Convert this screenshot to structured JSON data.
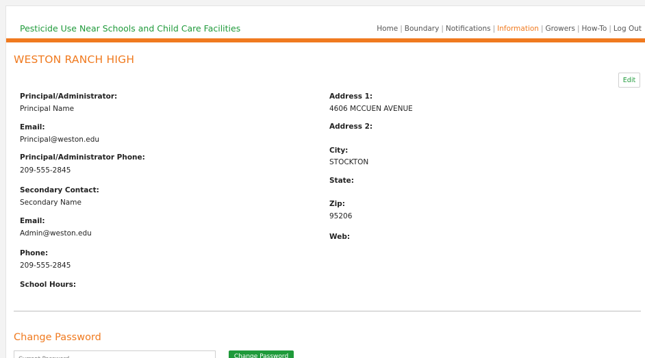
{
  "header": {
    "site_title": "Pesticide Use Near Schools and Child Care Facilities",
    "nav": [
      "Home",
      "Boundary",
      "Notifications",
      "Information",
      "Growers",
      "How-To",
      "Log Out"
    ],
    "active_nav": "Information",
    "separator": "|"
  },
  "school": {
    "name": "WESTON RANCH HIGH",
    "edit_label": "Edit"
  },
  "left_fields": [
    {
      "label": "Principal/Administrator:",
      "value": "Principal Name"
    },
    {
      "label": "Email:",
      "value": "Principal@weston.edu"
    },
    {
      "label": "Principal/Administrator Phone:",
      "value": "209-555-2845"
    },
    {
      "label": "Secondary Contact:",
      "value": "Secondary Name"
    },
    {
      "label": "Email:",
      "value": "Admin@weston.edu"
    },
    {
      "label": "Phone:",
      "value": "209-555-2845"
    },
    {
      "label": "School Hours:",
      "value": ""
    }
  ],
  "right_fields": [
    {
      "label": "Address 1:",
      "value": "4606 MCCUEN AVENUE"
    },
    {
      "label": "Address 2:",
      "value": ""
    },
    {
      "label": "City:",
      "value": "STOCKTON"
    },
    {
      "label": "State:",
      "value": ""
    },
    {
      "label": "Zip:",
      "value": "95206"
    },
    {
      "label": "Web:",
      "value": ""
    }
  ],
  "change_password": {
    "heading": "Change Password",
    "current_placeholder": "Current Password",
    "button_label": "Change Password"
  },
  "colors": {
    "accent_orange": "#f07a1f",
    "brand_green": "#1f9a3a"
  }
}
